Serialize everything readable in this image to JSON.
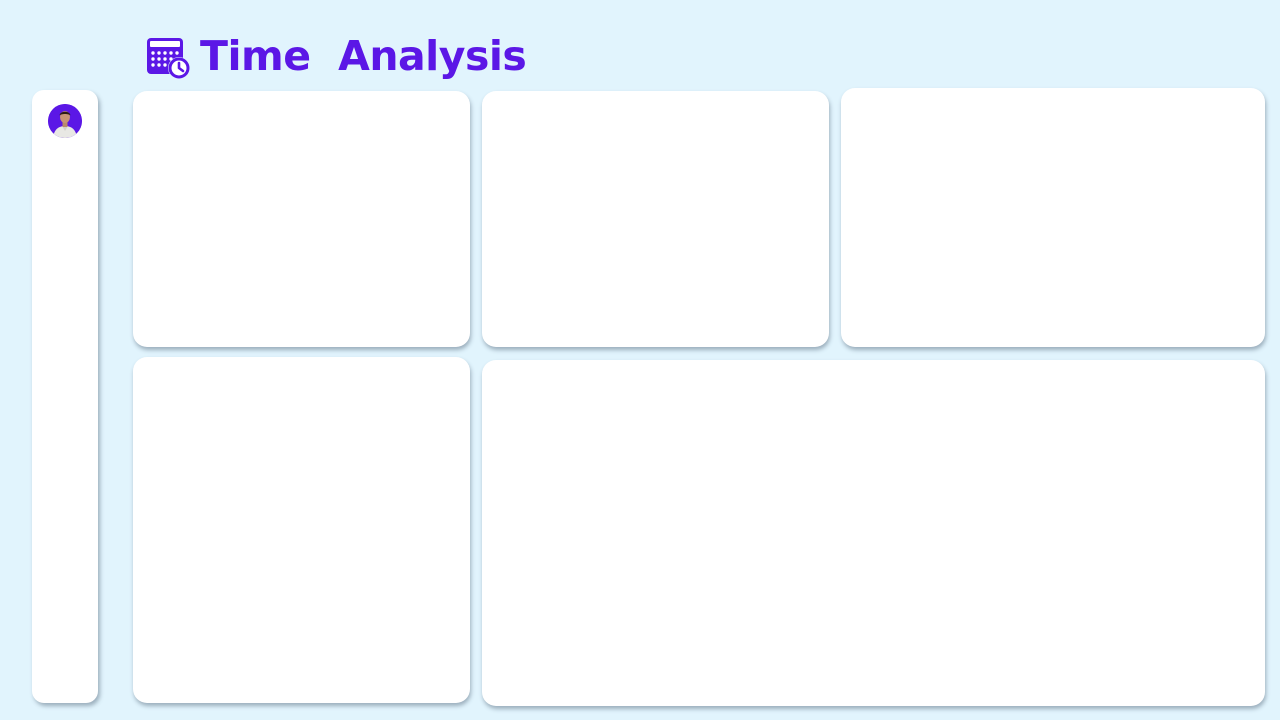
{
  "header": {
    "icon": "calendar-clock-icon",
    "title": "Time  Analysis",
    "accent_color": "#5B17E6"
  },
  "sidebar": {
    "avatar": "user-avatar"
  },
  "colors": {
    "background": "#E1F4FD",
    "card": "#FFFFFF"
  }
}
